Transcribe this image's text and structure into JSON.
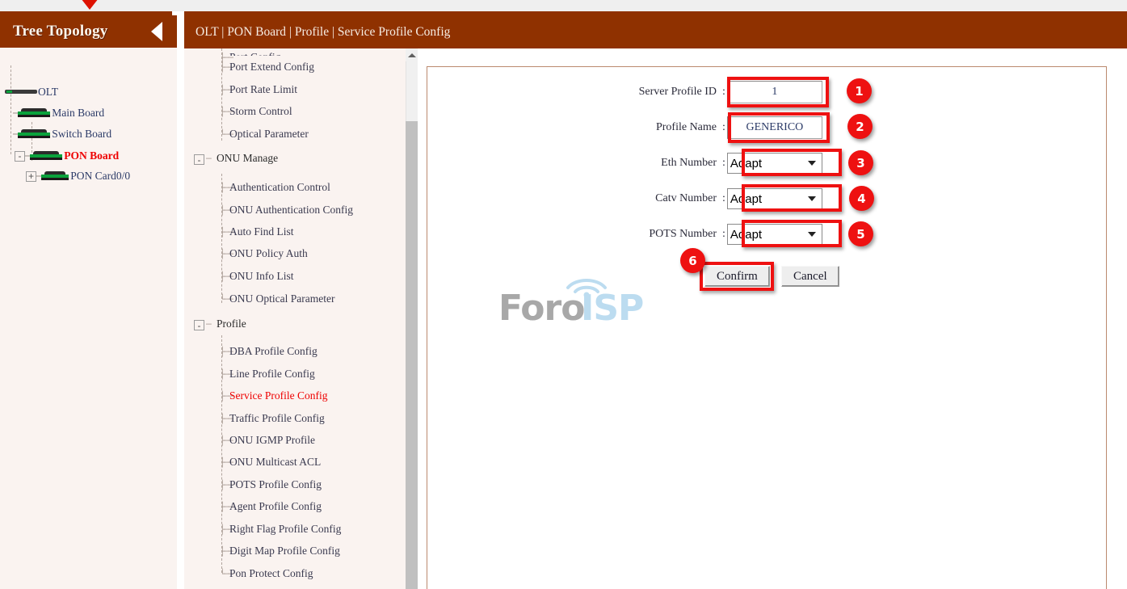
{
  "window": {
    "cursor_marker": "red-down-arrow"
  },
  "tree_panel": {
    "title": "Tree Topology",
    "collapse_icon": "chevron-left-icon",
    "nodes": [
      {
        "label": "OLT",
        "level": 0,
        "icon": "olt-device-icon",
        "expander": "",
        "active": false
      },
      {
        "label": "Main Board",
        "level": 1,
        "icon": "board-device-icon",
        "expander": "",
        "active": false
      },
      {
        "label": "Switch Board",
        "level": 1,
        "icon": "board-device-icon",
        "expander": "",
        "active": false
      },
      {
        "label": "PON Board",
        "level": 1,
        "icon": "board-device-icon",
        "expander": "-",
        "active": true
      },
      {
        "label": "PON Card0/0",
        "level": 2,
        "icon": "board-device-icon",
        "expander": "+",
        "active": false
      }
    ]
  },
  "content_header": {
    "breadcrumb": "OLT | PON Board | Profile | Service Profile Config"
  },
  "nav": {
    "items": [
      {
        "label": "Port Config",
        "type": "leaf",
        "active": false,
        "clipped": true
      },
      {
        "label": "Port Extend Config",
        "type": "leaf",
        "active": false
      },
      {
        "label": "Port Rate Limit",
        "type": "leaf",
        "active": false
      },
      {
        "label": "Storm Control",
        "type": "leaf",
        "active": false
      },
      {
        "label": "Optical Parameter",
        "type": "leaf",
        "active": false,
        "last": true
      },
      {
        "label": "ONU Manage",
        "type": "group",
        "active": false,
        "expander": "-"
      },
      {
        "label": "Authentication Control",
        "type": "leaf",
        "active": false
      },
      {
        "label": "ONU Authentication Config",
        "type": "leaf",
        "active": false
      },
      {
        "label": "Auto Find List",
        "type": "leaf",
        "active": false
      },
      {
        "label": "ONU Policy Auth",
        "type": "leaf",
        "active": false
      },
      {
        "label": "ONU Info List",
        "type": "leaf",
        "active": false
      },
      {
        "label": "ONU Optical Parameter",
        "type": "leaf",
        "active": false,
        "last": true
      },
      {
        "label": "Profile",
        "type": "group",
        "active": false,
        "expander": "-"
      },
      {
        "label": "DBA Profile Config",
        "type": "leaf",
        "active": false
      },
      {
        "label": "Line Profile Config",
        "type": "leaf",
        "active": false
      },
      {
        "label": "Service Profile Config",
        "type": "leaf",
        "active": true
      },
      {
        "label": "Traffic Profile Config",
        "type": "leaf",
        "active": false
      },
      {
        "label": "ONU IGMP Profile",
        "type": "leaf",
        "active": false
      },
      {
        "label": "ONU Multicast ACL",
        "type": "leaf",
        "active": false
      },
      {
        "label": "POTS Profile Config",
        "type": "leaf",
        "active": false
      },
      {
        "label": "Agent Profile Config",
        "type": "leaf",
        "active": false
      },
      {
        "label": "Right Flag Profile Config",
        "type": "leaf",
        "active": false
      },
      {
        "label": "Digit Map Profile Config",
        "type": "leaf",
        "active": false
      },
      {
        "label": "Pon Protect Config",
        "type": "leaf",
        "active": false,
        "last": true
      }
    ],
    "scrollbar": {
      "up_arrow_icon": "caret-up-icon"
    }
  },
  "watermark": {
    "text_primary": "Foro",
    "text_secondary": "ISP",
    "color_primary": "#a8a8a8",
    "color_secondary": "#bcdcf0"
  },
  "form": {
    "colon": ":",
    "fields": [
      {
        "label": "Server Profile ID",
        "kind": "text",
        "value": "1",
        "badge": "1"
      },
      {
        "label": "Profile Name",
        "kind": "text",
        "value": "GENERICO",
        "badge": "2"
      },
      {
        "label": "Eth Number",
        "kind": "select",
        "value": "Adapt",
        "badge": "3"
      },
      {
        "label": "Catv Number",
        "kind": "select",
        "value": "Adapt",
        "badge": "4"
      },
      {
        "label": "POTS Number",
        "kind": "select",
        "value": "Adapt",
        "badge": "5"
      }
    ],
    "buttons": {
      "confirm": "Confirm",
      "cancel": "Cancel",
      "confirm_badge": "6"
    }
  },
  "colors": {
    "brand": "#8f3100",
    "highlight": "#ee1111",
    "active_link": "#ee0000",
    "panel_bg": "#faf3f0"
  }
}
